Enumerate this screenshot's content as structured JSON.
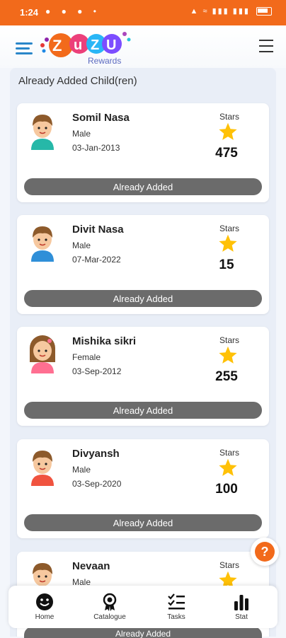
{
  "status_bar": {
    "time": "1:24"
  },
  "app": {
    "logo_text": "ZuZU",
    "logo_sub": "Rewards"
  },
  "section": {
    "title": "Already Added Child(ren)"
  },
  "stars_label": "Stars",
  "button_label": "Already Added",
  "children": [
    {
      "name": "Somil Nasa",
      "gender": "Male",
      "dob": "03-Jan-2013",
      "stars": "475",
      "avatar": "boy-icon"
    },
    {
      "name": "Divit Nasa",
      "gender": "Male",
      "dob": "07-Mar-2022",
      "stars": "15",
      "avatar": "boy-icon"
    },
    {
      "name": "Mishika sikri",
      "gender": "Female",
      "dob": "03-Sep-2012",
      "stars": "255",
      "avatar": "girl-icon"
    },
    {
      "name": "Divyansh",
      "gender": "Male",
      "dob": "03-Sep-2020",
      "stars": "100",
      "avatar": "boy-icon"
    },
    {
      "name": "Nevaan",
      "gender": "Male",
      "dob": "",
      "stars": "",
      "avatar": "boy-icon"
    }
  ],
  "nav": [
    {
      "label": "Home",
      "icon": "smiley-icon"
    },
    {
      "label": "Catalogue",
      "icon": "award-icon"
    },
    {
      "label": "Tasks",
      "icon": "checklist-icon"
    },
    {
      "label": "Stat",
      "icon": "bar-chart-icon"
    }
  ],
  "colors": {
    "accent": "#f26a1b",
    "button": "#6b6b6b",
    "star": "#ffc107"
  }
}
